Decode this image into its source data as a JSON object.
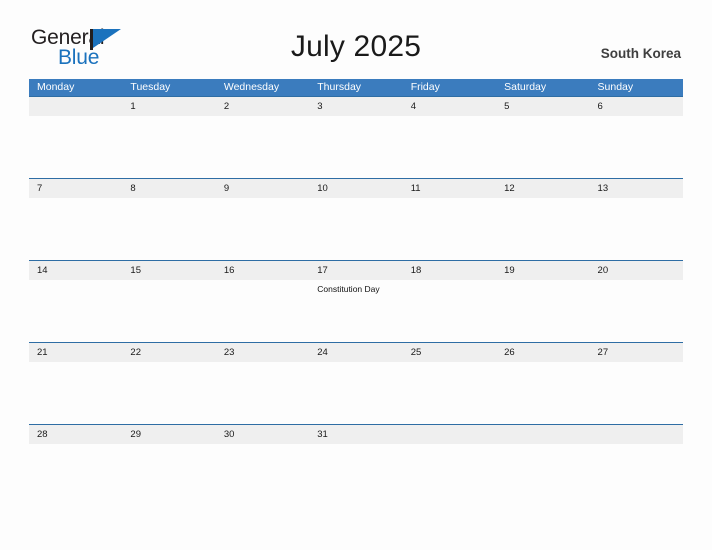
{
  "logo": {
    "word_top": "General",
    "word_bottom": "Blue",
    "flag_icon": "blue-flag-icon",
    "brand_color": "#1b72bd",
    "text_color": "#231f20"
  },
  "header": {
    "title": "July 2025",
    "region": "South Korea"
  },
  "calendar": {
    "header_bg": "#3b7cbe",
    "band_bg": "#efefef",
    "divider_color": "#2e6da4",
    "weekdays": [
      "Monday",
      "Tuesday",
      "Wednesday",
      "Thursday",
      "Friday",
      "Saturday",
      "Sunday"
    ],
    "weeks": [
      [
        {
          "date": "",
          "event": ""
        },
        {
          "date": "1",
          "event": ""
        },
        {
          "date": "2",
          "event": ""
        },
        {
          "date": "3",
          "event": ""
        },
        {
          "date": "4",
          "event": ""
        },
        {
          "date": "5",
          "event": ""
        },
        {
          "date": "6",
          "event": ""
        }
      ],
      [
        {
          "date": "7",
          "event": ""
        },
        {
          "date": "8",
          "event": ""
        },
        {
          "date": "9",
          "event": ""
        },
        {
          "date": "10",
          "event": ""
        },
        {
          "date": "11",
          "event": ""
        },
        {
          "date": "12",
          "event": ""
        },
        {
          "date": "13",
          "event": ""
        }
      ],
      [
        {
          "date": "14",
          "event": ""
        },
        {
          "date": "15",
          "event": ""
        },
        {
          "date": "16",
          "event": ""
        },
        {
          "date": "17",
          "event": "Constitution Day"
        },
        {
          "date": "18",
          "event": ""
        },
        {
          "date": "19",
          "event": ""
        },
        {
          "date": "20",
          "event": ""
        }
      ],
      [
        {
          "date": "21",
          "event": ""
        },
        {
          "date": "22",
          "event": ""
        },
        {
          "date": "23",
          "event": ""
        },
        {
          "date": "24",
          "event": ""
        },
        {
          "date": "25",
          "event": ""
        },
        {
          "date": "26",
          "event": ""
        },
        {
          "date": "27",
          "event": ""
        }
      ],
      [
        {
          "date": "28",
          "event": ""
        },
        {
          "date": "29",
          "event": ""
        },
        {
          "date": "30",
          "event": ""
        },
        {
          "date": "31",
          "event": ""
        },
        {
          "date": "",
          "event": ""
        },
        {
          "date": "",
          "event": ""
        },
        {
          "date": "",
          "event": ""
        }
      ]
    ]
  }
}
